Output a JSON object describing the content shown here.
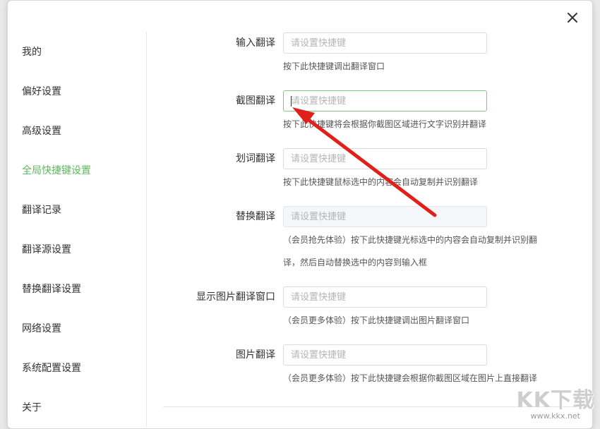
{
  "sidebar": {
    "items": [
      {
        "label": "我的",
        "active": false
      },
      {
        "label": "偏好设置",
        "active": false
      },
      {
        "label": "高级设置",
        "active": false
      },
      {
        "label": "全局快捷键设置",
        "active": true
      },
      {
        "label": "翻译记录",
        "active": false
      },
      {
        "label": "翻译源设置",
        "active": false
      },
      {
        "label": "替换翻译设置",
        "active": false
      },
      {
        "label": "网络设置",
        "active": false
      },
      {
        "label": "系统配置设置",
        "active": false
      },
      {
        "label": "关于",
        "active": false
      }
    ]
  },
  "shortcuts": [
    {
      "label": "输入翻译",
      "placeholder": "请设置快捷键",
      "hint": "按下此快捷键调出翻译窗口"
    },
    {
      "label": "截图翻译",
      "placeholder": "请设置快捷键",
      "hint": "按下此快捷键将会根据你截图区域进行文字识别并翻译"
    },
    {
      "label": "划词翻译",
      "placeholder": "请设置快捷键",
      "hint": "按下此快捷键鼠标选中的内容会自动复制并识别翻译"
    },
    {
      "label": "替换翻译",
      "placeholder": "请设置快捷键",
      "hint": "（会员抢先体验）按下此快捷键光标选中的内容会自动复制并识别翻",
      "hint2": "译，然后自动替换选中的内容到输入框"
    },
    {
      "label": "显示图片翻译窗口",
      "placeholder": "请设置快捷键",
      "hint": "（会员更多体验）按下此快捷键调出图片翻译窗口"
    },
    {
      "label": "图片翻译",
      "placeholder": "请设置快捷键",
      "hint": "（会员更多体验）按下此快捷键会根据你截图区域在图片上直接翻译"
    }
  ],
  "icons": {
    "close": "close-icon",
    "annotation": "red-arrow"
  },
  "colors": {
    "accent": "#5cb85c",
    "focus_border": "#7ec97e",
    "arrow": "#e0201b"
  },
  "watermark": {
    "logo": "KK下载",
    "url": "www.kkx.net"
  }
}
